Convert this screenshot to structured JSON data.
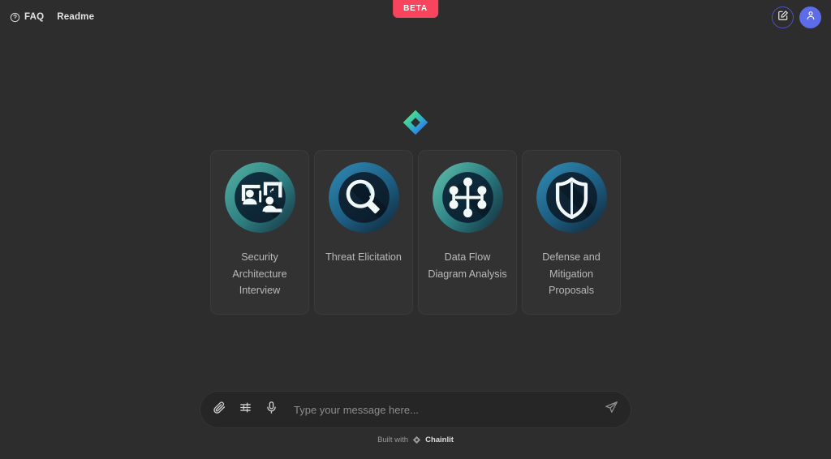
{
  "app": {
    "background_color": "#2d2d2d",
    "accent_color": "#5d6ce8",
    "badge_color": "#f9445e"
  },
  "topbar": {
    "faq_label": "FAQ",
    "readme_label": "Readme",
    "beta_label": "BETA",
    "help_icon": "question-circle-icon",
    "new_chat_icon": "pencil-square-icon",
    "avatar_icon": "user-icon"
  },
  "welcome": {
    "logo_icon": "chainlit-diamond-logo"
  },
  "starters": [
    {
      "label": "Security Architecture Interview",
      "icon": "interview-people-icon",
      "circle_from": "#4fa99e",
      "circle_to": "#16313f"
    },
    {
      "label": "Threat Elicitation",
      "icon": "magnifying-glass-icon",
      "circle_from": "#2b7fa6",
      "circle_to": "#11283a"
    },
    {
      "label": "Data Flow Diagram Analysis",
      "icon": "node-graph-icon",
      "circle_from": "#59b4a5",
      "circle_to": "#15303e"
    },
    {
      "label": "Defense and Mitigation Proposals",
      "icon": "shield-icon",
      "circle_from": "#2f84ab",
      "circle_to": "#112a3c"
    }
  ],
  "composer": {
    "placeholder": "Type your message here...",
    "value": "",
    "attach_icon": "paperclip-icon",
    "settings_icon": "sliders-icon",
    "mic_icon": "microphone-icon",
    "send_icon": "send-paper-plane-icon"
  },
  "footer": {
    "built_with": "Built with",
    "brand": "Chainlit",
    "logo_icon": "chainlit-diamond-logo"
  }
}
